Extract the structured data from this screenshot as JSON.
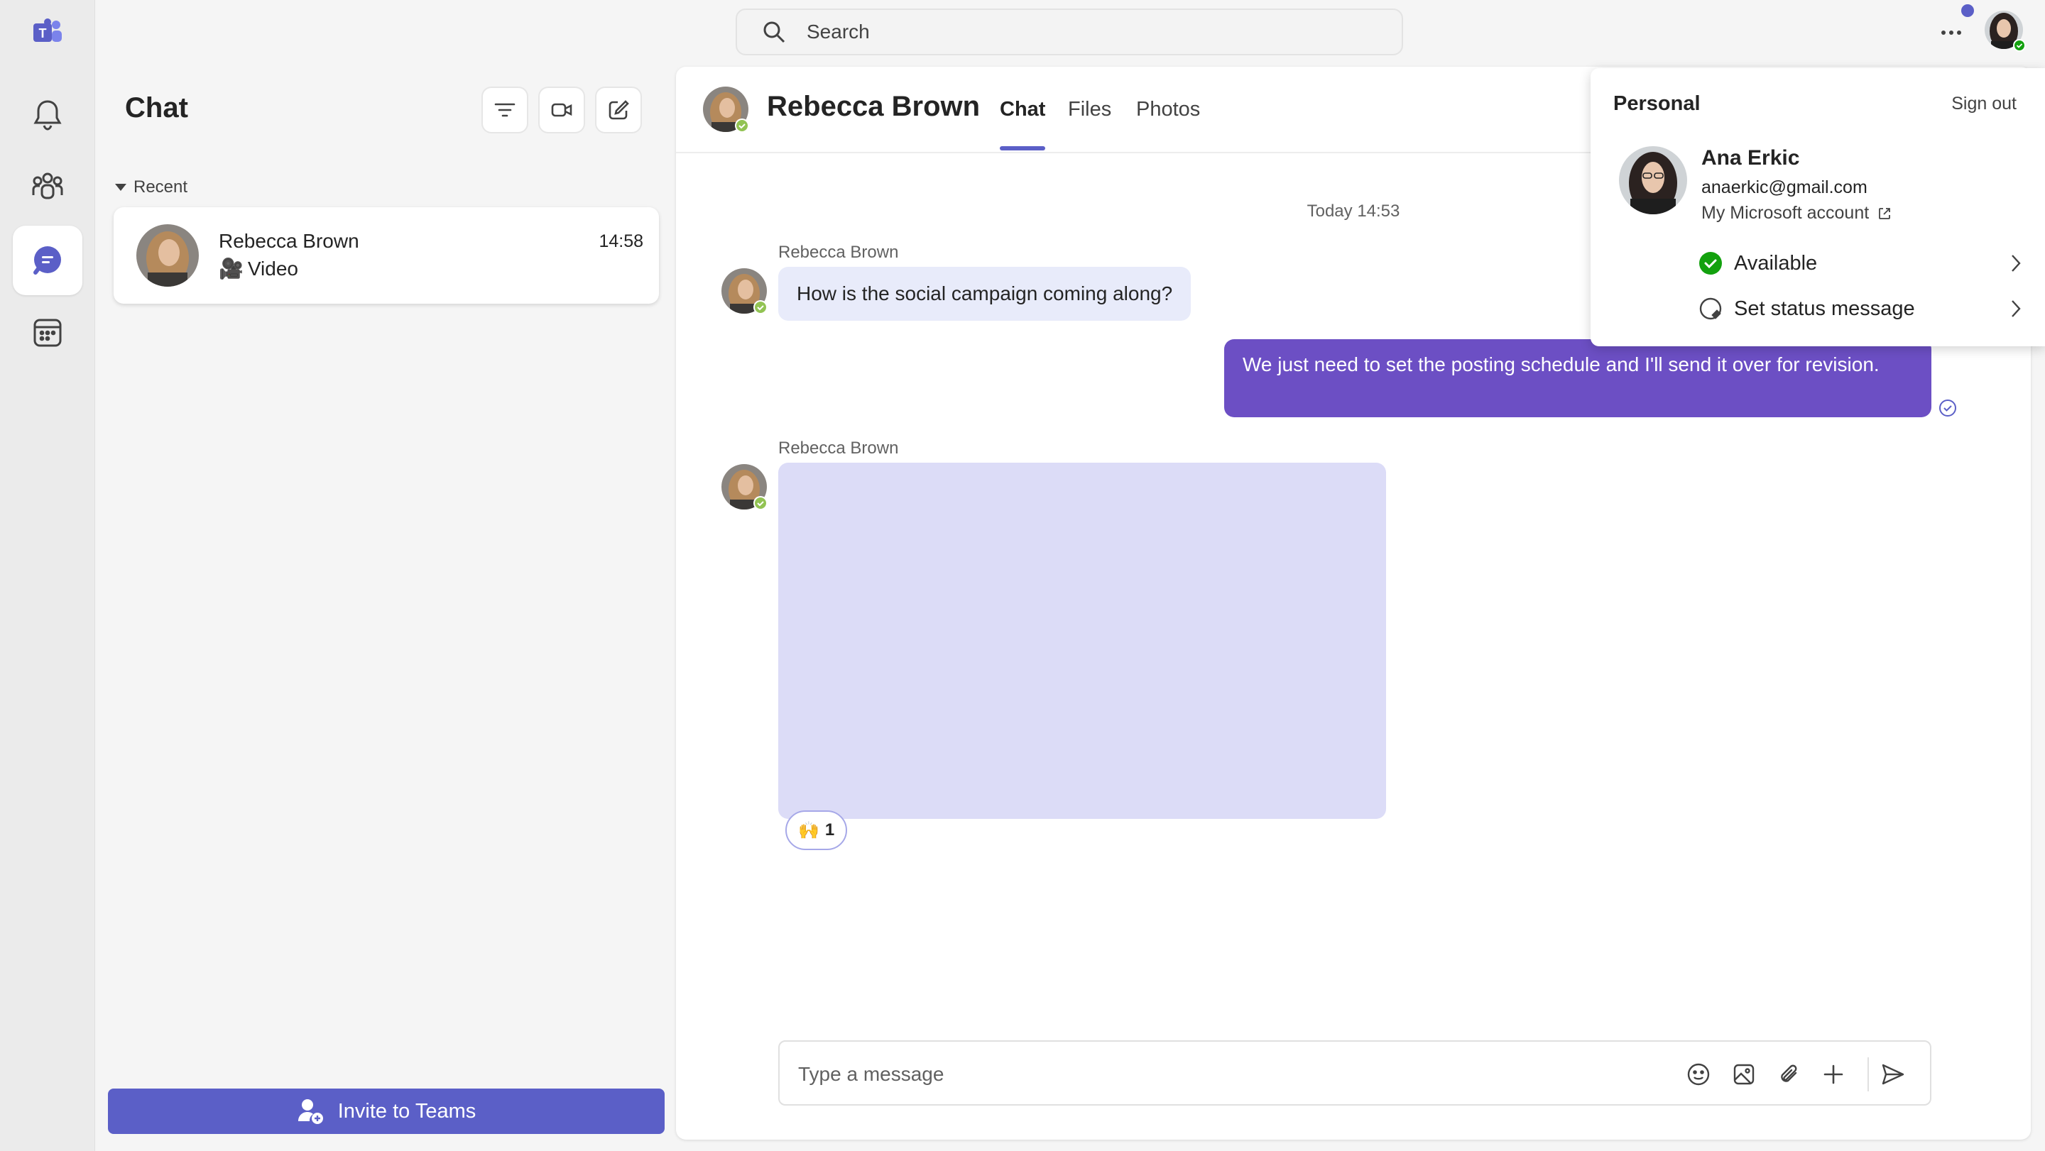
{
  "app": {
    "search_placeholder": "Search",
    "more_icon": "more-horizontal-icon"
  },
  "rail": {
    "items": [
      {
        "name": "teams-logo-icon"
      },
      {
        "name": "bell-icon"
      },
      {
        "name": "communities-icon"
      },
      {
        "name": "chat-icon",
        "active": true
      },
      {
        "name": "calendar-icon"
      }
    ],
    "accent": "#5b5fc7"
  },
  "chat_list": {
    "title": "Chat",
    "tools": [
      "filter-icon",
      "video-call-icon",
      "new-chat-icon"
    ],
    "section_label": "Recent",
    "items": [
      {
        "name": "Rebecca Brown",
        "time": "14:58",
        "preview_icon": "🎥",
        "preview": "Video"
      }
    ],
    "invite_label": "Invite to Teams"
  },
  "conversation": {
    "title": "Rebecca Brown",
    "tabs": [
      {
        "label": "Chat",
        "active": true
      },
      {
        "label": "Files"
      },
      {
        "label": "Photos"
      }
    ],
    "date_divider": "Today 14:53",
    "messages": [
      {
        "sender": "Rebecca Brown",
        "text": "How is the social campaign coming along?",
        "direction": "in"
      },
      {
        "sender": "",
        "text": "We just need to set the posting schedule and I'll send it over for revision.",
        "direction": "out"
      },
      {
        "sender": "Rebecca Brown",
        "text": "",
        "direction": "in",
        "attachment": "image",
        "reaction": {
          "emoji": "🙌",
          "count": "1"
        }
      }
    ],
    "composer_placeholder": "Type a message",
    "composer_icons": [
      "emoji-icon",
      "image-icon",
      "attach-icon",
      "plus-icon",
      "send-icon"
    ],
    "outgoing_color": "#6c4fc4",
    "incoming_color": "#e8ebfa"
  },
  "account": {
    "section": "Personal",
    "sign_out": "Sign out",
    "name": "Ana Erkic",
    "email": "anaerkic@gmail.com",
    "account_link": "My Microsoft account",
    "status": "Available",
    "status_color": "#13a10e",
    "set_status": "Set status message"
  }
}
